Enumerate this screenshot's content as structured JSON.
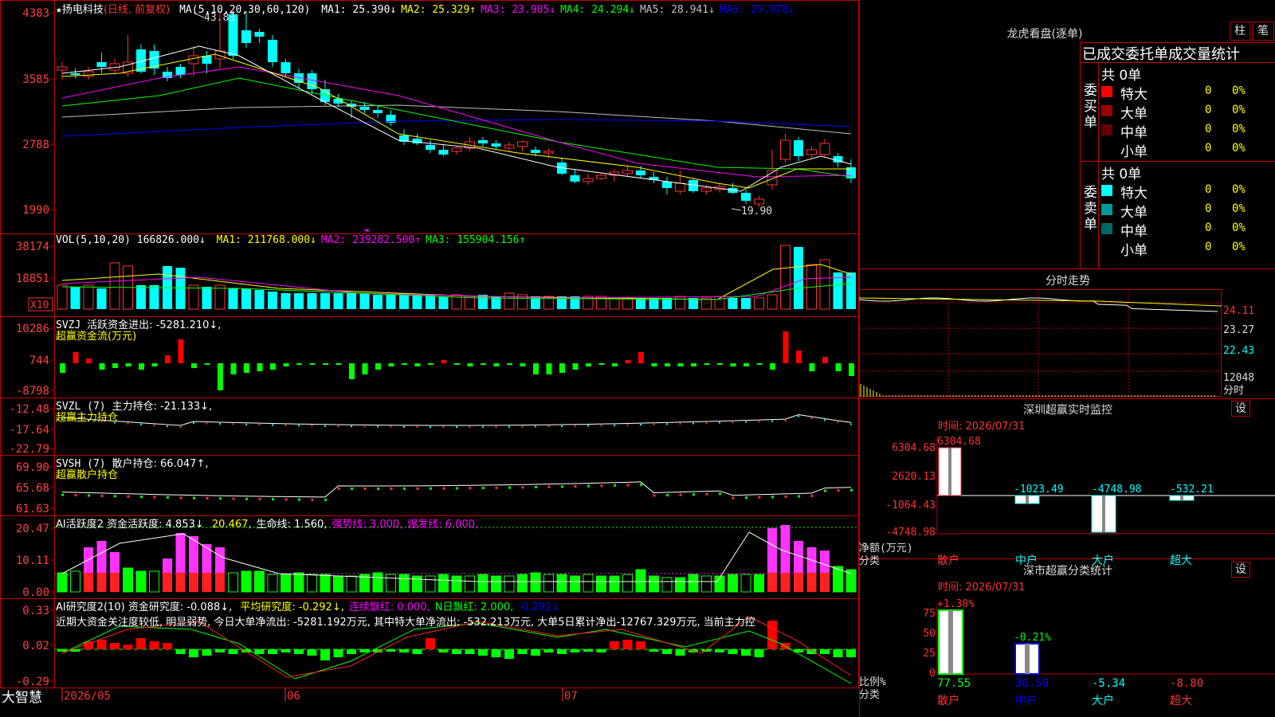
{
  "stock": {
    "star": "★",
    "name": "扬电科技",
    "mode": "(日线, 前复权)"
  },
  "ma_header": {
    "label": "MA(5,10,20,30,60,120)",
    "items": [
      {
        "name": "MA1:",
        "value": "25.390↓",
        "color": "#ffffff"
      },
      {
        "name": "MA2:",
        "value": "25.329↑",
        "color": "#ffff00"
      },
      {
        "name": "MA3:",
        "value": "23.905↓",
        "color": "#ff00ff"
      },
      {
        "name": "MA4:",
        "value": "24.294↓",
        "color": "#00ff00"
      },
      {
        "name": "MA5:",
        "value": "28.941↓",
        "color": "#c0c0c0"
      },
      {
        "name": "MA6:",
        "value": "29.978↓",
        "color": "#0000ff"
      }
    ]
  },
  "price_axis": [
    "4383",
    "3585",
    "2788",
    "1990"
  ],
  "price_annotations": {
    "high": "43.83",
    "low": "19.90"
  },
  "vol_header": {
    "label": "VOL(5,10,20)",
    "value": "166826.000↓",
    "items": [
      {
        "text": "MA1: 211768.000↓",
        "color": "#ffff00"
      },
      {
        "text": "MA2: 239282.500↑",
        "color": "#ff00ff"
      },
      {
        "text": "MA3: 155904.156↑",
        "color": "#00ff00"
      }
    ]
  },
  "vol_axis": [
    "38174",
    "18851"
  ],
  "vol_unit": "X10",
  "svzj": {
    "name": "SVZJ",
    "text": "活跃资金进出: -5281.210↓,",
    "sub": "超赢资金流(万元)",
    "axis": [
      "10286",
      "744",
      "-8798"
    ]
  },
  "svzl": {
    "name": "SVZL (7)",
    "text": "主力持仓: -21.133↓,",
    "sub": "超赢主力持仓",
    "axis": [
      "-12.48",
      "-17.64",
      "-22.79"
    ]
  },
  "svsh": {
    "name": "SVSH (7)",
    "text": "散户持仓: 66.047↑,",
    "sub": "超赢散户持仓",
    "axis": [
      "69.90",
      "65.68",
      "61.63"
    ]
  },
  "ai_active": {
    "title": "AI活跃度2 资金活跃度: 4.853↓",
    "items": [
      {
        "text": "20.467,",
        "color": "#ffff00"
      },
      {
        "text": "生命线: 1.560,",
        "color": "#ffffff"
      },
      {
        "text": "强势线: 3.000,",
        "color": "#ff00ff"
      },
      {
        "text": "爆发线: 6.000,",
        "color": "#ff00ff"
      }
    ],
    "axis": [
      "20.47",
      "10.11",
      "0.00"
    ]
  },
  "ai_research": {
    "title": "AI研究度2(10) 资金研究度: -0.088↓,",
    "items": [
      {
        "text": "平均研究度: -0.292↓,",
        "color": "#ffff00"
      },
      {
        "text": "连续飘红: 0.000,",
        "color": "#ff00ff"
      },
      {
        "text": "N日飘红: 2.000,",
        "color": "#00ff00"
      },
      {
        "text": "-0.292↓",
        "color": "#0000ff"
      }
    ],
    "note": "近期大资金关注度较低, 明显弱势, 今日大单净流出: -5281.192万元, 其中特大单净流出: -532.213万元, 大单5日累计净出-12767.329万元, 当前主力控",
    "axis": [
      "0.33",
      "0.02",
      "-0.29"
    ]
  },
  "date_axis": [
    "2026/05",
    "06",
    "07"
  ],
  "brand": "大智慧",
  "right_panel": {
    "dragon_title": "龙虎看盘(逐单)",
    "btn_bar": "柱",
    "btn_pen": "笔",
    "stats_title": "已成交委托单成交量统计",
    "buy_label": "委买单",
    "sell_label": "委卖单",
    "buy_total": "共 0单",
    "sell_total": "共 0单",
    "buy_rows": [
      {
        "label": "特大",
        "count": "0",
        "pct": "0%",
        "color": "#ff0000"
      },
      {
        "label": "大单",
        "count": "0",
        "pct": "0%",
        "color": "#990000"
      },
      {
        "label": "中单",
        "count": "0",
        "pct": "0%",
        "color": "#660000"
      },
      {
        "label": "小单",
        "count": "0",
        "pct": "0%",
        "color": "#000000"
      }
    ],
    "sell_rows": [
      {
        "label": "特大",
        "count": "0",
        "pct": "0%",
        "color": "#00ffff"
      },
      {
        "label": "大单",
        "count": "0",
        "pct": "0%",
        "color": "#009999"
      },
      {
        "label": "中单",
        "count": "0",
        "pct": "0%",
        "color": "#006666"
      },
      {
        "label": "小单",
        "count": "0",
        "pct": "0%",
        "color": "#000000"
      }
    ],
    "intraday_title": "分时走势",
    "intraday_axis": [
      "24.11",
      "23.27",
      "22.43",
      "12048",
      "分时"
    ],
    "sz_monitor": {
      "title": "深圳超赢实时监控",
      "btn": "设",
      "time": "时间: 2026/07/31",
      "axis": [
        "6304.68",
        "2620.13",
        "-1064.43",
        "-4748.98"
      ],
      "ylabel": "净额(万元)",
      "xlabel": "分类",
      "categories": [
        "散户",
        "中户",
        "大户",
        "超大"
      ],
      "values": [
        "6304.68",
        "-1023.49",
        "-4748.98",
        "-532.21"
      ]
    },
    "sz_class": {
      "title": "深市超赢分类统计",
      "btn": "设",
      "time": "时间: 2026/07/31",
      "axis": [
        "75",
        "50",
        "25",
        "0"
      ],
      "ylabel": "比例%",
      "xlabel": "分类",
      "categories": [
        "散户",
        "中户",
        "大户",
        "超大"
      ],
      "top_labels": [
        "+1.30%",
        "-0.21%"
      ],
      "values": [
        "77.55",
        "36.59",
        "-5.34",
        "-8.80"
      ]
    }
  },
  "colors": {
    "up": "#ff3232",
    "down": "#00ffff",
    "grid": "#c00000",
    "flow_up": "#ff0000",
    "flow_down": "#00ff00"
  },
  "chart_data": {
    "type": "candlestick",
    "date_labels": [
      "2026/05",
      "06",
      "07"
    ],
    "price_range": [
      19.9,
      43.83
    ],
    "ma_lines": [
      "MA1",
      "MA2",
      "MA3",
      "MA4",
      "MA5",
      "MA6"
    ]
  }
}
